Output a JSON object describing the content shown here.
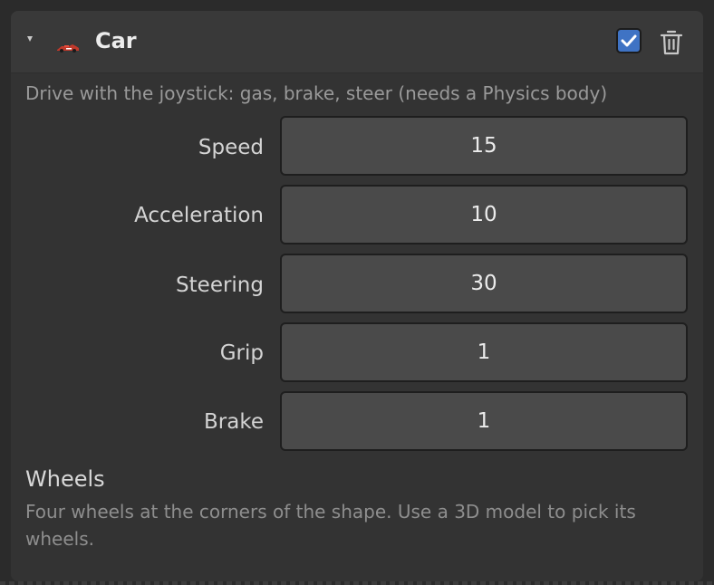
{
  "component": {
    "title": "Car",
    "icon": "race-car-icon",
    "enabled": true,
    "description": "Drive with the joystick: gas, brake, steer (needs a Physics body)"
  },
  "fields": [
    {
      "label": "Speed",
      "value": "15"
    },
    {
      "label": "Acceleration",
      "value": "10"
    },
    {
      "label": "Steering",
      "value": "30"
    },
    {
      "label": "Grip",
      "value": "1"
    },
    {
      "label": "Brake",
      "value": "1"
    }
  ],
  "wheels": {
    "title": "Wheels",
    "description": "Four wheels at the corners of the shape. Use a 3D model to pick its wheels."
  },
  "colors": {
    "accent": "#3f73c4",
    "panel": "#333333",
    "field": "#4a4a4a"
  }
}
